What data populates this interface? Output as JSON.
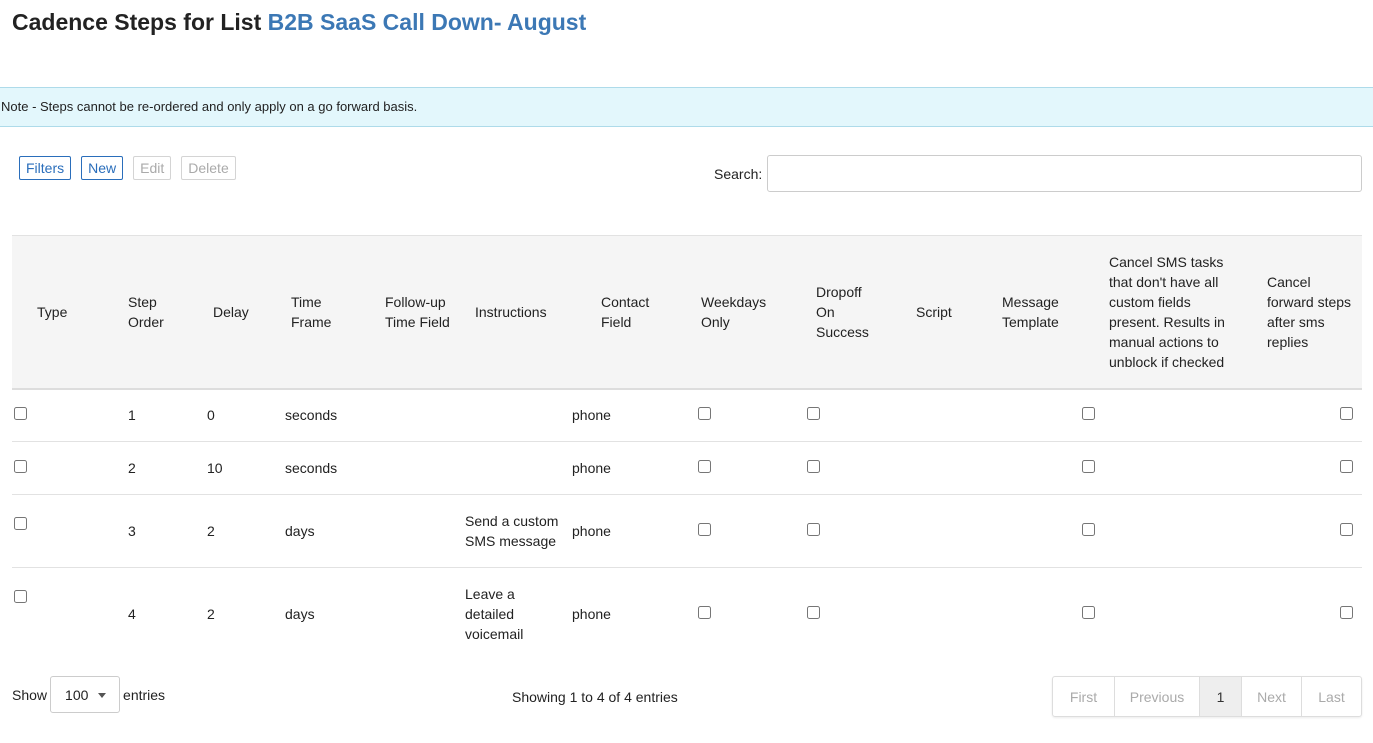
{
  "page": {
    "title_prefix": "Cadence Steps for List ",
    "list_name": "B2B SaaS Call Down- August",
    "note": "Note - Steps cannot be re-ordered and only apply on a go forward basis."
  },
  "toolbar": {
    "filters_label": "Filters",
    "new_label": "New",
    "edit_label": "Edit",
    "delete_label": "Delete"
  },
  "search": {
    "label": "Search:",
    "value": "",
    "placeholder": ""
  },
  "table": {
    "headers": {
      "type": "Type",
      "step_order": "Step Order",
      "delay": "Delay",
      "time_frame": "Time Frame",
      "followup_time_field": "Follow-up Time Field",
      "instructions": "Instructions",
      "contact_field": "Contact Field",
      "weekdays_only": "Weekdays Only",
      "dropoff_on_success": "Dropoff On Success",
      "script": "Script",
      "message_template": "Message Template",
      "cancel_sms_tasks": "Cancel SMS tasks that don't have all custom fields present. Results in manual actions to unblock if checked",
      "cancel_forward_steps": "Cancel forward steps after sms replies"
    },
    "rows": [
      {
        "step_order": "1",
        "delay": "0",
        "time_frame": "seconds",
        "instructions": "",
        "contact_field": "phone"
      },
      {
        "step_order": "2",
        "delay": "10",
        "time_frame": "seconds",
        "instructions": "",
        "contact_field": "phone"
      },
      {
        "step_order": "3",
        "delay": "2",
        "time_frame": "days",
        "instructions": "Send a custom SMS message",
        "contact_field": "phone"
      },
      {
        "step_order": "4",
        "delay": "2",
        "time_frame": "days",
        "instructions": "Leave a detailed voicemail",
        "contact_field": "phone"
      }
    ]
  },
  "footer": {
    "show_label": "Show",
    "page_size": "100",
    "entries_label": "entries",
    "info": "Showing 1 to 4 of 4 entries",
    "pagination": {
      "first": "First",
      "previous": "Previous",
      "current": "1",
      "next": "Next",
      "last": "Last"
    }
  }
}
